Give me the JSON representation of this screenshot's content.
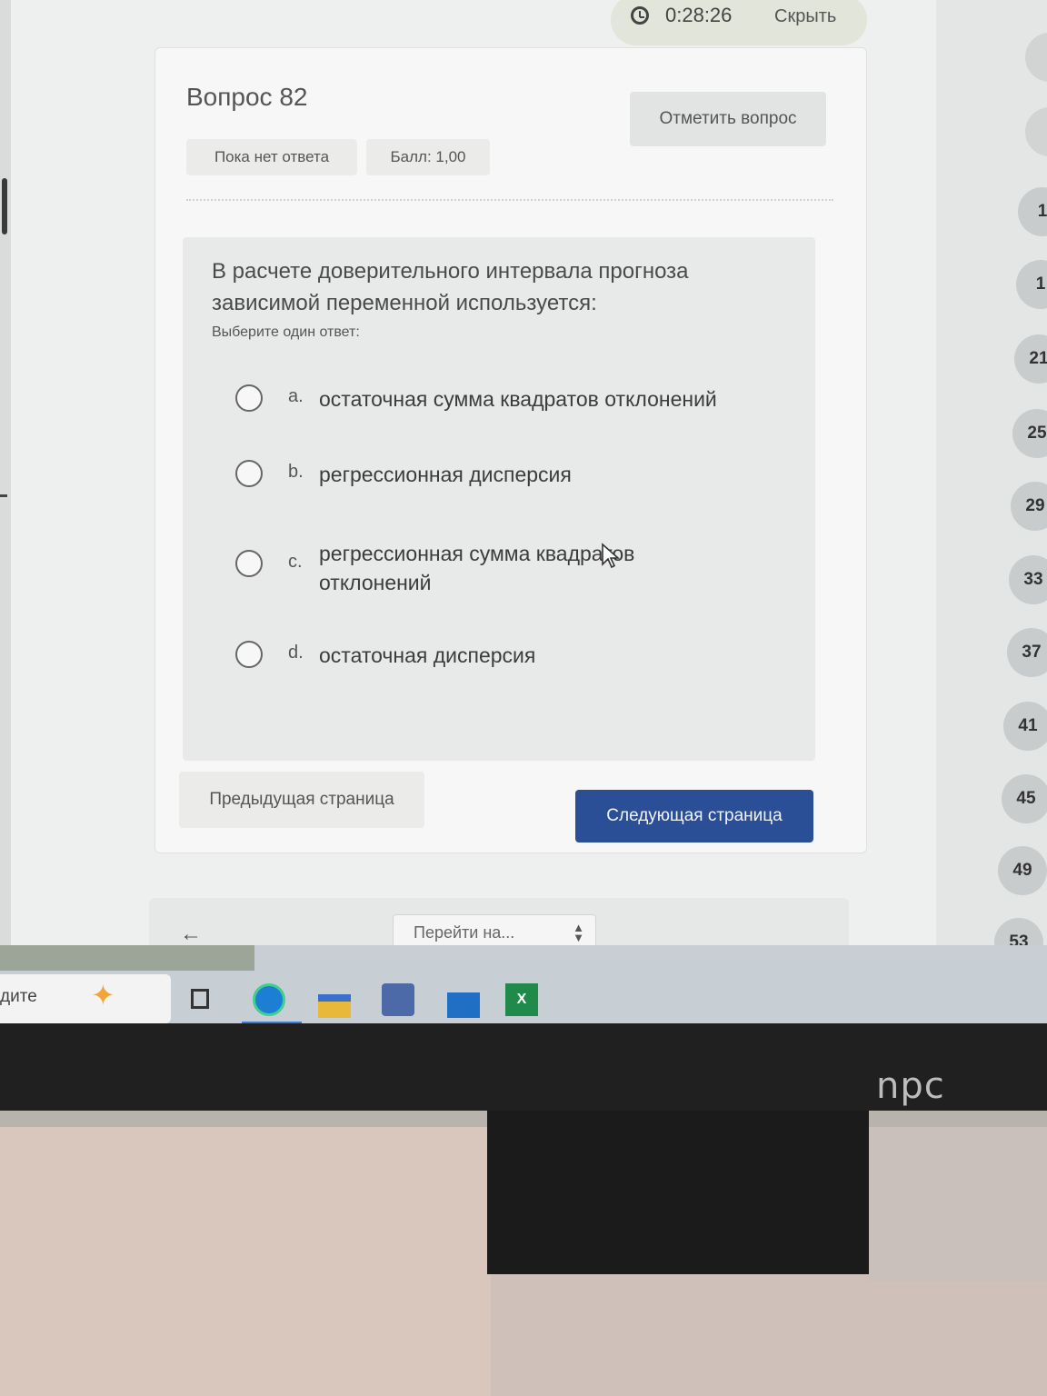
{
  "timer": {
    "time": "0:28:26",
    "hide_label": "Скрыть"
  },
  "question": {
    "title": "Вопрос 82",
    "flag_label": "Отметить вопрос",
    "status": "Пока нет ответа",
    "score": "Балл: 1,00",
    "text": "В расчете доверительного интервала прогноза зависимой переменной используется:",
    "hint": "Выберите один ответ:",
    "options": [
      {
        "letter": "a.",
        "text": "остаточная сумма квадратов отклонений"
      },
      {
        "letter": "b.",
        "text": "регрессионная дисперсия"
      },
      {
        "letter": "c.",
        "text": "регрессионная сумма квадратов отклонений"
      },
      {
        "letter": "d.",
        "text": "остаточная дисперсия"
      }
    ]
  },
  "navigation": {
    "prev_label": "Предыдущая страница",
    "next_label": "Следующая страница",
    "jump_placeholder": "Перейти на...",
    "question_numbers": [
      "1",
      "1",
      "21",
      "25",
      "29",
      "33",
      "37",
      "41",
      "45",
      "49",
      "53"
    ]
  },
  "taskbar": {
    "search_text": "дите",
    "icons": [
      "task-view-icon",
      "edge-icon",
      "folder-icon",
      "store-icon",
      "mail-icon",
      "excel-icon"
    ],
    "excel_letter": "X"
  },
  "monitor_brand": "npc"
}
